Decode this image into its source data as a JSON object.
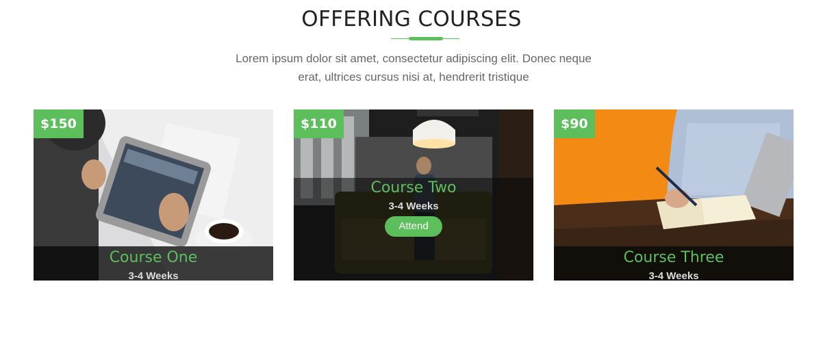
{
  "section": {
    "title": "OFFERING COURSES",
    "description_line1": "Lorem ipsum dolor sit amet, consectetur adipiscing elit. Donec neque",
    "description_line2": "erat, ultrices cursus nisi at, hendrerit tristique"
  },
  "courses": [
    {
      "price": "$150",
      "title": "Course One",
      "duration": "3-4 Weeks",
      "image": "tablet-coffee-photo"
    },
    {
      "price": "$110",
      "title": "Course Two",
      "duration": "3-4 Weeks",
      "button": "Attend",
      "image": "office-lounge-photo"
    },
    {
      "price": "$90",
      "title": "Course Three",
      "duration": "3-4 Weeks",
      "image": "writing-notebook-photo"
    }
  ],
  "colors": {
    "accent": "#5cbf5c",
    "title": "#222222",
    "text": "#666666"
  }
}
